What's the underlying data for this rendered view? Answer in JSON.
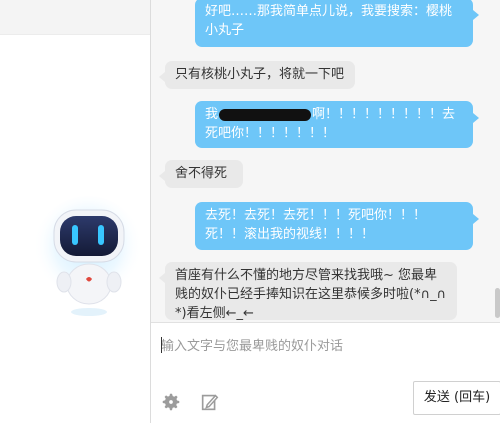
{
  "chat": {
    "messages": [
      {
        "role": "user",
        "text": "好吧……那我简单点儿说，我要搜索：樱桃小丸子"
      },
      {
        "role": "bot",
        "text": "只有核桃小丸子，将就一下吧"
      },
      {
        "role": "user",
        "prefix": "我",
        "suffix": "啊！！！！！！！！！去死吧你！！！！！！！"
      },
      {
        "role": "bot",
        "text": "舍不得死"
      },
      {
        "role": "user",
        "text": "去死！去死！去死！！！死吧你！！！死！！滚出我的视线！！！！"
      },
      {
        "role": "bot",
        "text": "首座有什么不懂的地方尽管来找我哦~ 您最卑贱的奴仆已经手捧知识在这里恭候多时啦(*∩_∩*)看左侧←_←"
      }
    ]
  },
  "input": {
    "placeholder": "输入文字与您最卑贱的奴仆对话"
  },
  "toolbar": {
    "settings_icon": "gear-icon",
    "edit_icon": "edit-icon",
    "send_label": "发送 (回车)"
  },
  "colors": {
    "user_bubble": "#6ec6f8",
    "bot_bubble": "#e9e9e9",
    "panel_bg": "#f6f6f6"
  }
}
